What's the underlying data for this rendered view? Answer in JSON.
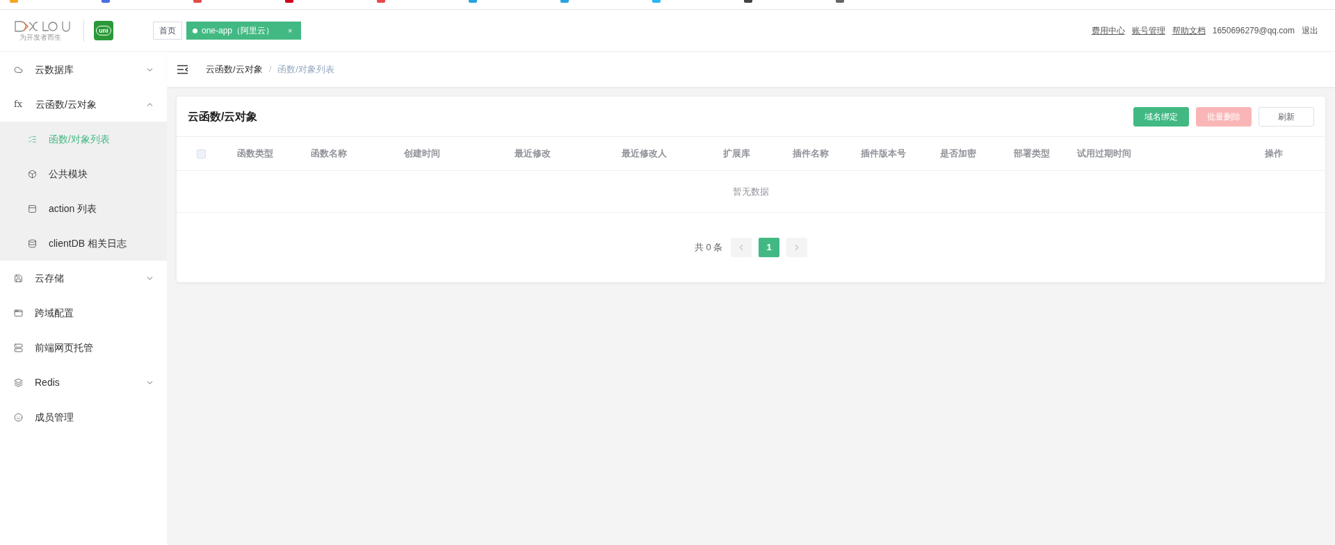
{
  "header": {
    "logo_caption": "为开发者而生",
    "app_badge": "uni",
    "tabs": [
      {
        "label": "首页",
        "selected": false
      },
      {
        "label": "one-app（阿里云）",
        "selected": true,
        "close": "×"
      }
    ],
    "links": [
      {
        "label": "费用中心",
        "kind": "link"
      },
      {
        "label": "账号管理",
        "kind": "link"
      },
      {
        "label": "帮助文档",
        "kind": "link"
      },
      {
        "label": "1650696279@qq.com",
        "kind": "text"
      },
      {
        "label": "退出",
        "kind": "text"
      }
    ]
  },
  "sidebar": {
    "items": [
      {
        "label": "云数据库",
        "expanded": false,
        "selected": false
      },
      {
        "label": "云函数/云对象",
        "icon_text": "fx",
        "expanded": true,
        "selected": false,
        "children": [
          {
            "label": "函数/对象列表",
            "selected": true
          },
          {
            "label": "公共模块",
            "selected": false
          },
          {
            "label": "action 列表",
            "selected": false
          },
          {
            "label": "clientDB 相关日志",
            "selected": false
          }
        ]
      },
      {
        "label": "云存储",
        "expanded": false,
        "selected": false
      },
      {
        "label": "跨域配置",
        "selected": false
      },
      {
        "label": "前端网页托管",
        "selected": false
      },
      {
        "label": "Redis",
        "expanded": false,
        "selected": false
      },
      {
        "label": "成员管理",
        "selected": false
      }
    ]
  },
  "breadcrumb": [
    "云函数/云对象",
    "函数/对象列表"
  ],
  "breadcrumb_separator": "/",
  "card": {
    "title": "云函数/云对象",
    "buttons": [
      {
        "label": "域名绑定",
        "kind": "primary"
      },
      {
        "label": "批量删除",
        "kind": "danger"
      },
      {
        "label": "刷新",
        "kind": "default"
      }
    ],
    "table": {
      "select_all_checked": false,
      "columns": [
        "函数类型",
        "函数名称",
        "创建时间",
        "最近修改",
        "最近修改人",
        "扩展库",
        "插件名称",
        "插件版本号",
        "是否加密",
        "部署类型",
        "试用过期时间",
        "操作"
      ],
      "empty_text": "暂无数据"
    },
    "pagination": {
      "total": "共 0 条",
      "pages": [
        {
          "label": "1",
          "selected": true
        }
      ],
      "prev_disabled": true,
      "next_disabled": true
    }
  }
}
